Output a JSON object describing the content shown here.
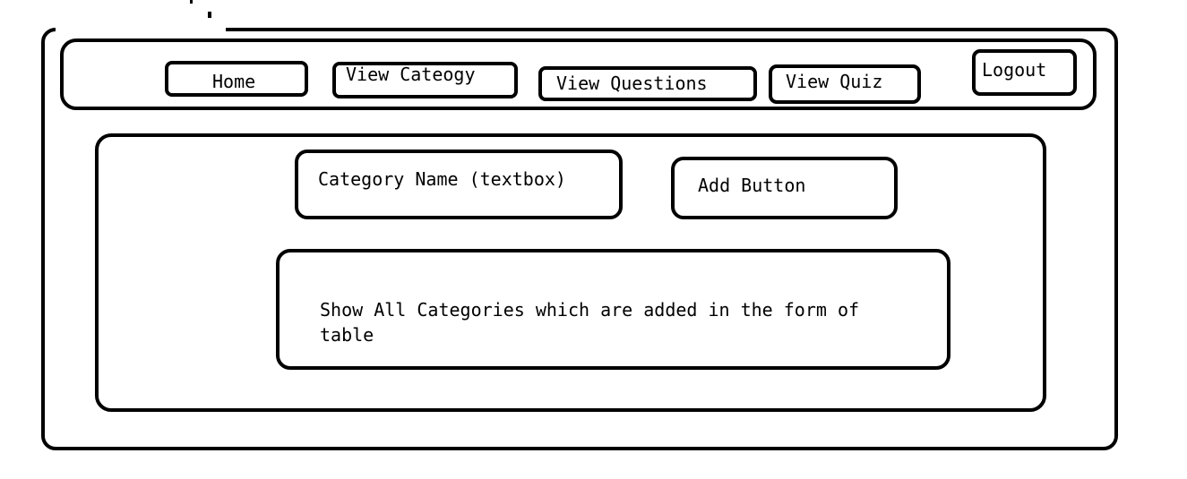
{
  "nav": {
    "home_label": "Home",
    "view_category_label": "View Cateogy",
    "view_questions_label": "View Questions",
    "view_quiz_label": "View Quiz",
    "logout_label": "Logout"
  },
  "form": {
    "category_name_placeholder": "Category Name (textbox)",
    "add_button_label": "Add Button"
  },
  "table_area": {
    "text": "Show All Categories which are added in the form of table"
  }
}
